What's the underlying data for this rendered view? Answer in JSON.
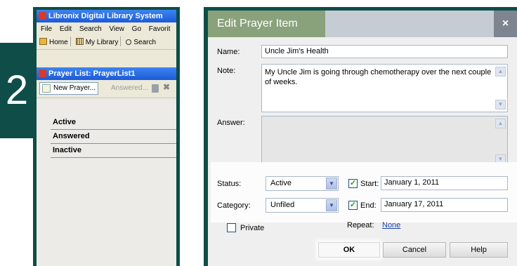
{
  "step": {
    "number": "2"
  },
  "libronix": {
    "title": "Libronix Digital Library System",
    "menu": [
      "File",
      "Edit",
      "Search",
      "View",
      "Go",
      "Favorit"
    ],
    "toolbar": {
      "home": "Home",
      "my_library": "My Library",
      "search": "Search"
    }
  },
  "prayer_list": {
    "title": "Prayer List: PrayerList1",
    "new_prayer": "New Prayer...",
    "answered_btn": "Answered...",
    "categories": [
      "Active",
      "Answered",
      "Inactive"
    ]
  },
  "dialog": {
    "title": "Edit Prayer Item",
    "close": "×",
    "name_label": "Name:",
    "name_value": "Uncle Jim's Health",
    "note_label": "Note:",
    "note_value": "My Uncle Jim is going through chemotherapy over the next couple of weeks.",
    "answer_label": "Answer:",
    "answer_value": "",
    "status_label": "Status:",
    "status_value": "Active",
    "category_label": "Category:",
    "category_value": "Unfiled",
    "start_label": "Start:",
    "start_checked": true,
    "start_value": "January 1, 2011",
    "end_label": "End:",
    "end_checked": true,
    "end_value": "January 17, 2011",
    "private_label": "Private",
    "private_checked": false,
    "repeat_label": "Repeat:",
    "repeat_value": "None",
    "ok": "OK",
    "cancel": "Cancel",
    "help": "Help"
  },
  "colors": {
    "badge": "#0f4d48",
    "xp_title": "#1c5ad8",
    "dialog_title": "#8aa27c",
    "link": "#1c43a8"
  }
}
